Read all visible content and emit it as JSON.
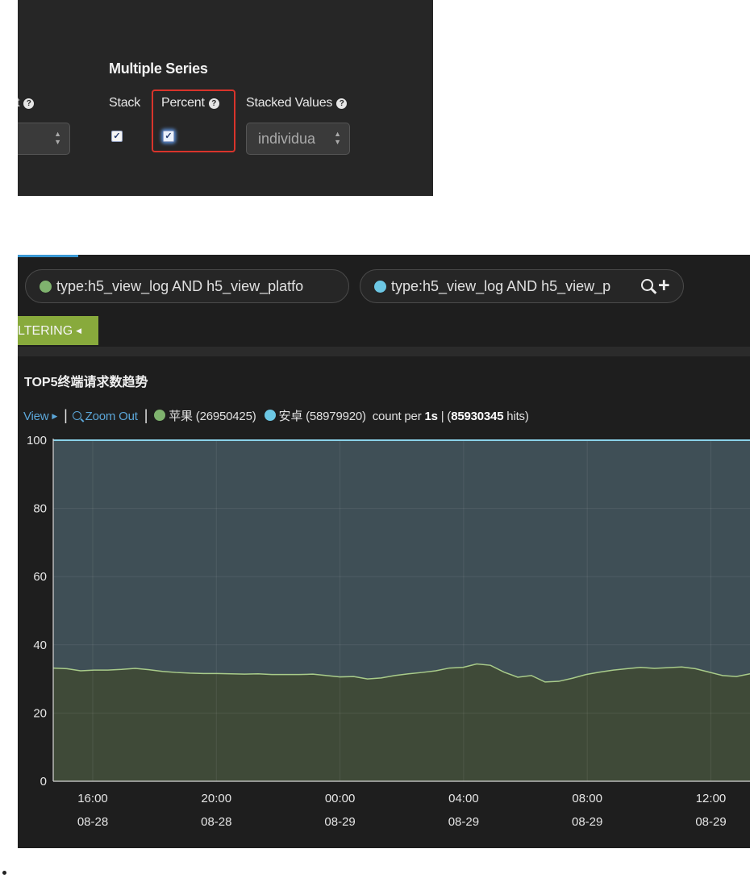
{
  "settings": {
    "section_title": "Multiple Series",
    "truncated_label": "t",
    "stack_label": "Stack",
    "percent_label": "Percent",
    "stacked_values_label": "Stacked Values",
    "stacked_values_value": "individua",
    "stack_checked": true,
    "percent_checked": true,
    "help_glyph": "?",
    "check_glyph": "✓",
    "arrow_up": "▲",
    "arrow_down": "▼",
    "highlight_color": "#d9342b"
  },
  "queries": [
    {
      "text": "type:h5_view_log AND h5_view_platfo",
      "color": "#7fb36e"
    },
    {
      "text": "type:h5_view_log AND h5_view_p",
      "color": "#6cc7e4"
    }
  ],
  "filter_tab": {
    "label": "LTERING",
    "caret": "◀"
  },
  "panel": {
    "title": "TOP5终端请求数趋势",
    "view_label": "View",
    "view_caret": "▶",
    "zoom_out_label": "Zoom Out",
    "legend": [
      {
        "label": "苹果 (26950425)",
        "color": "#7fb36e"
      },
      {
        "label": "安卓 (58979920)",
        "color": "#6cc7e4"
      }
    ],
    "count_prefix": "count per ",
    "interval": "1s",
    "hits_prefix": "(",
    "hits_total": "85930345",
    "hits_suffix": " hits)"
  },
  "chart_data": {
    "type": "area",
    "stacked": true,
    "percent": true,
    "ylim": [
      0,
      100
    ],
    "yticks": [
      0,
      20,
      40,
      60,
      80,
      100
    ],
    "xticks": [
      {
        "time": "16:00",
        "date": "08-28"
      },
      {
        "time": "20:00",
        "date": "08-28"
      },
      {
        "time": "00:00",
        "date": "08-29"
      },
      {
        "time": "04:00",
        "date": "08-29"
      },
      {
        "time": "08:00",
        "date": "08-29"
      },
      {
        "time": "12:00",
        "date": "08-29"
      }
    ],
    "grid": true,
    "series": [
      {
        "name": "苹果",
        "color": "#7fb36e",
        "values": [
          33.2,
          33.0,
          32.4,
          32.6,
          32.6,
          32.8,
          33.1,
          32.7,
          32.2,
          31.9,
          31.7,
          31.6,
          31.6,
          31.5,
          31.4,
          31.5,
          31.3,
          31.3,
          31.3,
          31.4,
          31.0,
          30.6,
          30.7,
          30.0,
          30.3,
          31.0,
          31.5,
          31.9,
          32.4,
          33.2,
          33.4,
          34.4,
          34.0,
          32.0,
          30.5,
          31.0,
          29.1,
          29.3,
          30.2,
          31.3,
          32.0,
          32.6,
          33.0,
          33.4,
          33.1,
          33.3,
          33.5,
          33.0,
          32.0,
          31.0,
          30.7,
          31.5
        ]
      },
      {
        "name": "安卓",
        "color": "#6cc7e4",
        "values": [
          66.8,
          67.0,
          67.6,
          67.4,
          67.4,
          67.2,
          66.9,
          67.3,
          67.8,
          68.1,
          68.3,
          68.4,
          68.4,
          68.5,
          68.6,
          68.5,
          68.7,
          68.7,
          68.7,
          68.6,
          69.0,
          69.4,
          69.3,
          70.0,
          69.7,
          69.0,
          68.5,
          68.1,
          67.6,
          66.8,
          66.6,
          65.6,
          66.0,
          68.0,
          69.5,
          69.0,
          70.9,
          70.7,
          69.8,
          68.7,
          68.0,
          67.4,
          67.0,
          66.6,
          66.9,
          66.7,
          66.5,
          67.0,
          68.0,
          69.0,
          69.3,
          68.5
        ]
      }
    ]
  }
}
